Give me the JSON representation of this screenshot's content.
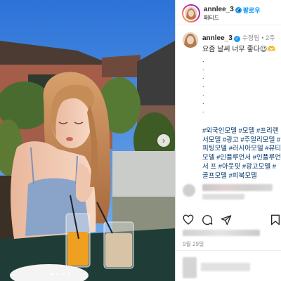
{
  "post": {
    "photo": {
      "slide_count": 4,
      "active_slide": 1
    },
    "header": {
      "username": "annlee_3",
      "follow_label": "팔로우",
      "separator": "•",
      "subtitle": "패티드"
    },
    "caption": {
      "username": "annlee_3",
      "edited_label": "수정됨",
      "separator": "•",
      "time": "2주",
      "text": "요즘 날씨 너무 좋다😉🫶",
      "spacer_dots": [
        ".",
        ".",
        ".",
        ".",
        ".",
        ".",
        "."
      ],
      "hashtags": "#외국인모델 #모델 #프리랜서모델 #광고 #주얼리모델 #피팅모델 #러시아모델 #뷰티모델 #인플루언서 #인플루언서 프 #아웃핏 #광고모델 #골프모델 #피북모델"
    },
    "date": "9월 29일"
  },
  "icons": {
    "like": "heart-icon",
    "comment": "comment-icon",
    "share": "paper-plane-icon",
    "save": "bookmark-icon",
    "verified": "verified-badge-icon",
    "next": "chevron-right-icon"
  },
  "colors": {
    "link_blue": "#0095f6",
    "hashtag_blue": "#00376b",
    "verified_blue": "#1d9bf0",
    "muted_gray": "#8e8e8e",
    "divider": "#dbdbdb"
  }
}
